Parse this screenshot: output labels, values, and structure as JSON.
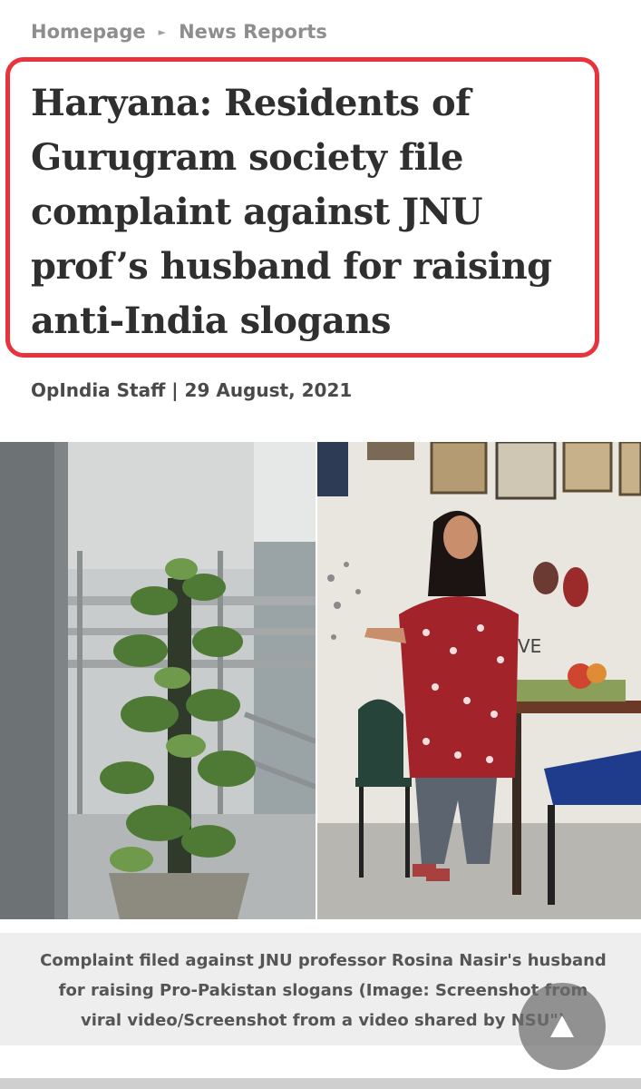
{
  "breadcrumb": {
    "home": "Homepage",
    "section": "News Reports"
  },
  "article": {
    "headline_lines": [
      "Haryana: Residents of",
      "Gurugram society file",
      "complaint against JNU",
      "prof’s husband for raising",
      "anti-India slogans"
    ],
    "author": "OpIndia Staff",
    "separator": "|",
    "date": "29 August, 2021"
  },
  "photo": {
    "wall_letters": "VE"
  },
  "caption_lines": [
    "Complaint filed against JNU professor Rosina Nasir's husband",
    "for raising Pro-Pakistan slogans (Image: Screenshot from",
    "viral video/Screenshot from a video shared by NSU\")"
  ],
  "controls": {
    "scroll_top_icon": "up-triangle-icon"
  },
  "colors": {
    "highlight_border": "#e8333c",
    "headline_text": "#2f2f2f",
    "breadcrumb_text": "#8e8e8e"
  }
}
